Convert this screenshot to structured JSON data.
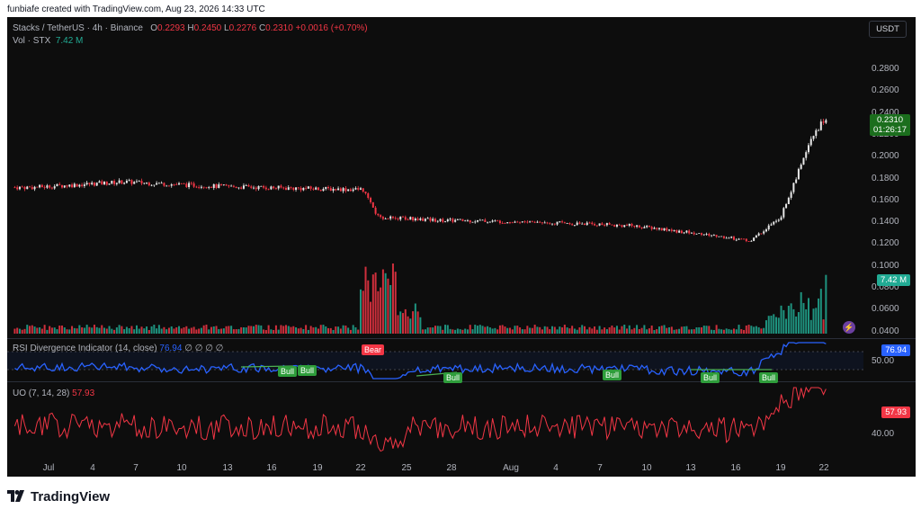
{
  "header": {
    "created_by": "funbiafe created with TradingView.com, Aug 23, 2026 14:33 UTC"
  },
  "legend": {
    "symbol": "Stacks / TetherUS · 4h · Binance",
    "o_label": "O",
    "o_value": "0.2293",
    "h_label": "H",
    "h_value": "0.2450",
    "l_label": "L",
    "l_value": "0.2276",
    "c_label": "C",
    "c_value": "0.2310",
    "change": "+0.0016 (+0.70%)",
    "vol_label": "Vol · STX",
    "vol_value": "7.42 M"
  },
  "currency_button": "USDT",
  "price_axis": [
    "0.2800",
    "0.2600",
    "0.2400",
    "0.2200",
    "0.2000",
    "0.1800",
    "0.1600",
    "0.1400",
    "0.1200",
    "0.1000",
    "0.0800",
    "0.0600",
    "0.0400"
  ],
  "price_tag": {
    "price": "0.2310",
    "countdown": "01:26:17"
  },
  "volume_tag": "7.42 M",
  "rsi": {
    "label": "RSI Divergence Indicator (14, close)",
    "value": "76.94",
    "empties": "∅ ∅ ∅ ∅",
    "axis_label": "50.00",
    "tag": "76.94",
    "signals": [
      "Bull",
      "Bull",
      "Bear",
      "Bull",
      "Bull",
      "Bull",
      "Bull"
    ]
  },
  "uo": {
    "label": "UO (7, 14, 28)",
    "value": "57.93",
    "axis_label": "40.00",
    "tag": "57.93"
  },
  "time_axis": [
    "Jul",
    "4",
    "7",
    "10",
    "13",
    "16",
    "19",
    "22",
    "25",
    "28",
    "Aug",
    "4",
    "7",
    "10",
    "13",
    "16",
    "19",
    "22"
  ],
  "footer": {
    "brand": "TradingView"
  },
  "colors": {
    "up": "#e8e8e8",
    "down": "#f23645",
    "vol_up": "#22ab94",
    "vol_down": "#f23645",
    "rsi": "#2962ff",
    "uo": "#f23645"
  },
  "chart_data": [
    {
      "type": "candlestick",
      "title": "Stacks / TetherUS · 4h · Binance",
      "ylim": [
        0.03,
        0.29
      ],
      "series": [
        {
          "name": "STXUSDT",
          "x": [
            "Jul 1",
            "Jul 7",
            "Jul 13",
            "Jul 19",
            "Jul 23",
            "Jul 24",
            "Jul 28",
            "Aug 4",
            "Aug 10",
            "Aug 16",
            "Aug 18",
            "Aug 20",
            "Aug 22",
            "Aug 23"
          ],
          "values": [
            0.167,
            0.172,
            0.168,
            0.166,
            0.165,
            0.14,
            0.137,
            0.135,
            0.132,
            0.122,
            0.118,
            0.14,
            0.21,
            0.231
          ]
        }
      ],
      "last": {
        "open": 0.2293,
        "high": 0.245,
        "low": 0.2276,
        "close": 0.231
      }
    },
    {
      "type": "bar",
      "title": "Vol · STX",
      "series": [
        {
          "name": "Volume",
          "last": "7.42 M"
        }
      ]
    },
    {
      "type": "line",
      "title": "RSI Divergence Indicator (14, close)",
      "ylim": [
        0,
        100
      ],
      "series": [
        {
          "name": "RSI",
          "last": 76.94
        }
      ]
    },
    {
      "type": "line",
      "title": "UO (7, 14, 28)",
      "series": [
        {
          "name": "UO",
          "last": 57.93
        }
      ]
    }
  ]
}
